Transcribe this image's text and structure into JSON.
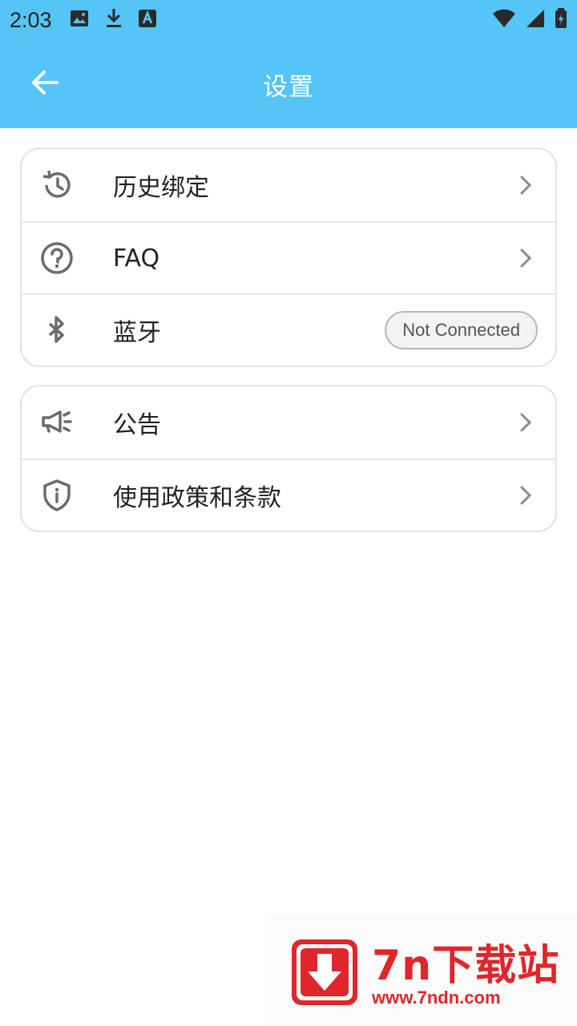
{
  "status_bar": {
    "time": "2:03",
    "left_icons": [
      "image-icon",
      "download-icon",
      "a-icon"
    ],
    "right_icons": [
      "wifi-icon",
      "signal-icon",
      "battery-charging-icon"
    ]
  },
  "app_bar": {
    "title": "设置",
    "back_icon": "arrow-left-icon",
    "background": "#55c5f7"
  },
  "groups": [
    {
      "items": [
        {
          "label": "历史绑定",
          "icon": "history-icon",
          "action": "chevron"
        },
        {
          "label": "FAQ",
          "icon": "help-circle-icon",
          "action": "chevron"
        },
        {
          "label": "蓝牙",
          "icon": "bluetooth-icon",
          "status": "Not Connected"
        }
      ]
    },
    {
      "items": [
        {
          "label": "公告",
          "icon": "megaphone-icon",
          "action": "chevron"
        },
        {
          "label": "使用政策和条款",
          "icon": "shield-info-icon",
          "action": "chevron"
        }
      ]
    }
  ],
  "watermark": {
    "title": "7n下载站",
    "url": "www.7ndn.com",
    "color": "#e1262b"
  }
}
